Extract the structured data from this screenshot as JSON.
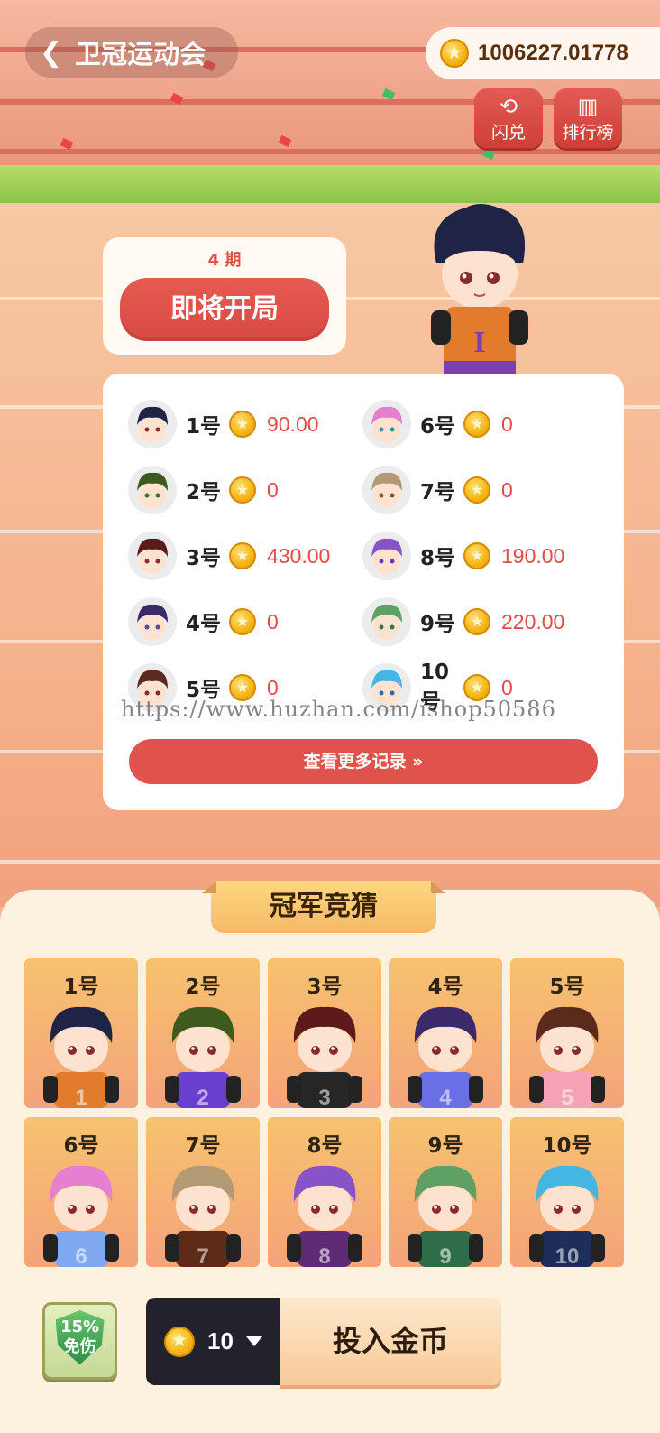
{
  "header": {
    "back_icon": "chevron-left-icon",
    "title": "卫冠运动会",
    "balance": "1006227.01778",
    "balance_icon": "coin-icon",
    "exchange_label": "闪兑",
    "exchange_icon": "exchange-icon",
    "ranking_label": "排行榜",
    "ranking_icon": "ranking-icon"
  },
  "round": {
    "period": "4 期",
    "status": "即将开局"
  },
  "results": [
    {
      "no": "1号",
      "amount": "90.00",
      "hair": "#1f2346"
    },
    {
      "no": "2号",
      "amount": "0",
      "hair": "#3e5a1c"
    },
    {
      "no": "3号",
      "amount": "430.00",
      "hair": "#5c1a1a"
    },
    {
      "no": "4号",
      "amount": "0",
      "hair": "#3b2a6a"
    },
    {
      "no": "5号",
      "amount": "0",
      "hair": "#5a2a1c"
    },
    {
      "no": "6号",
      "amount": "0",
      "hair": "#e57fd0"
    },
    {
      "no": "7号",
      "amount": "0",
      "hair": "#b39a74"
    },
    {
      "no": "8号",
      "amount": "190.00",
      "hair": "#8654c6"
    },
    {
      "no": "9号",
      "amount": "220.00",
      "hair": "#5fa064"
    },
    {
      "no": "10号",
      "amount": "0",
      "hair": "#45b6e4"
    }
  ],
  "watermark": "https://www.huzhan.com/ishop50586",
  "more_records_label": "查看更多记录 »",
  "guess": {
    "title": "冠军竞猜",
    "players": [
      {
        "no": "1号",
        "hair": "#1f2346",
        "jersey": "#e27b2c",
        "num": "1"
      },
      {
        "no": "2号",
        "hair": "#3e5a1c",
        "jersey": "#6a3fd0",
        "num": "2"
      },
      {
        "no": "3号",
        "hair": "#5c1a1a",
        "jersey": "#262626",
        "num": "3"
      },
      {
        "no": "4号",
        "hair": "#3b2a6a",
        "jersey": "#6b6fe6",
        "num": "4"
      },
      {
        "no": "5号",
        "hair": "#5a2a1c",
        "jersey": "#f7a3b6",
        "num": "5"
      },
      {
        "no": "6号",
        "hair": "#e57fd0",
        "jersey": "#7fa8f0",
        "num": "6"
      },
      {
        "no": "7号",
        "hair": "#b39a74",
        "jersey": "#5c2a16",
        "num": "7"
      },
      {
        "no": "8号",
        "hair": "#8654c6",
        "jersey": "#5e2a78",
        "num": "8"
      },
      {
        "no": "9号",
        "hair": "#5fa064",
        "jersey": "#2f6d4a",
        "num": "9"
      },
      {
        "no": "10号",
        "hair": "#45b6e4",
        "jersey": "#1f2d5a",
        "num": "10"
      }
    ]
  },
  "bottom": {
    "shield_percent": "15%",
    "shield_label": "免伤",
    "shield_icon": "shield-icon",
    "amount": "10",
    "amount_icon": "coin-icon",
    "dropdown_icon": "caret-down-icon",
    "submit_label": "投入金币"
  },
  "colors": {
    "accent_red": "#e0524c",
    "amount_red": "#e34b4b",
    "panel_bg": "#fdf1df"
  }
}
